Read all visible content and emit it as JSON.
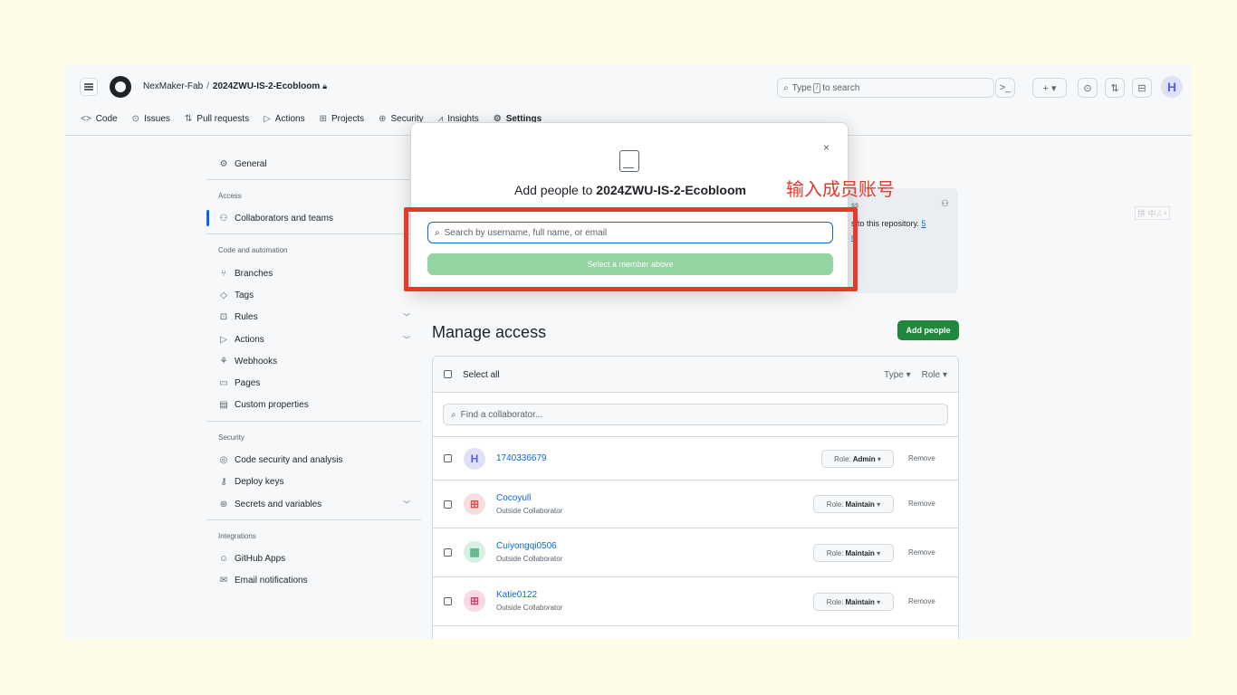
{
  "header": {
    "owner": "NexMaker-Fab",
    "separator": "/",
    "repo": "2024ZWU-IS-2-Ecobloom",
    "lock_icon": "lock-icon",
    "search_prefix": "Type",
    "search_key": "/",
    "search_suffix": "to search",
    "terminal": ">_",
    "plus": "+ ▾",
    "issue_icon": "⊙",
    "pr_icon": "⇅",
    "inbox_icon": "⊟"
  },
  "nav": {
    "code": "Code",
    "issues": "Issues",
    "pull_requests": "Pull requests",
    "actions": "Actions",
    "projects": "Projects",
    "security": "Security",
    "insights": "Insights",
    "settings": "Settings"
  },
  "sidebar": {
    "general": "General",
    "access_heading": "Access",
    "collaborators": "Collaborators and teams",
    "code_heading": "Code and automation",
    "branches": "Branches",
    "tags": "Tags",
    "rules": "Rules",
    "actions": "Actions",
    "webhooks": "Webhooks",
    "pages": "Pages",
    "custom_properties": "Custom properties",
    "security_heading": "Security",
    "code_security": "Code security and analysis",
    "deploy_keys": "Deploy keys",
    "secrets": "Secrets and variables",
    "integrations_heading": "Integrations",
    "github_apps": "GitHub Apps",
    "email_notifications": "Email notifications"
  },
  "notice": {
    "partial_heading": "ss",
    "text": "s to this repository.",
    "count": "5",
    "partial_link": "n"
  },
  "manage": {
    "title": "Manage access",
    "add_people": "Add people",
    "select_all": "Select all",
    "type_filter": "Type ▾",
    "role_filter": "Role ▾",
    "find_placeholder": "Find a collaborator..."
  },
  "members": [
    {
      "username": "1740336679",
      "subtitle": "",
      "role_label": "Role:",
      "role": "Admin",
      "remove": "Remove",
      "avatar_color": "#5a5fd8",
      "avatar_bg": "#dfe2f7"
    },
    {
      "username": "Cocoyull",
      "subtitle": "Outside Collaborator",
      "role_label": "Role:",
      "role": "Maintain",
      "remove": "Remove",
      "avatar_color": "#d9534f",
      "avatar_bg": "#f7dede"
    },
    {
      "username": "Cuiyongqi0506",
      "subtitle": "Outside Collaborator",
      "role_label": "Role:",
      "role": "Maintain",
      "remove": "Remove",
      "avatar_color": "#5cb38c",
      "avatar_bg": "#d8efe3"
    },
    {
      "username": "Katie0122",
      "subtitle": "Outside Collaborator",
      "role_label": "Role:",
      "role": "Maintain",
      "remove": "Remove",
      "avatar_color": "#c9456b",
      "avatar_bg": "#f6d9e2"
    }
  ],
  "modal": {
    "close": "×",
    "title_prefix": "Add people to",
    "title_repo": "2024ZWU-IS-2-Ecobloom",
    "search_placeholder": "Search by username, full name, or email",
    "select_button": "Select a member above"
  },
  "annotation": "输入成员账号",
  "ime_text": "拼 中 ⁄ᵣ ⁶",
  "colors": {
    "accent": "#0969da",
    "primary_button": "#1f883d",
    "disabled_button": "#94d3a2",
    "highlight": "#e33a2c",
    "page_bg": "#fefbe6"
  }
}
